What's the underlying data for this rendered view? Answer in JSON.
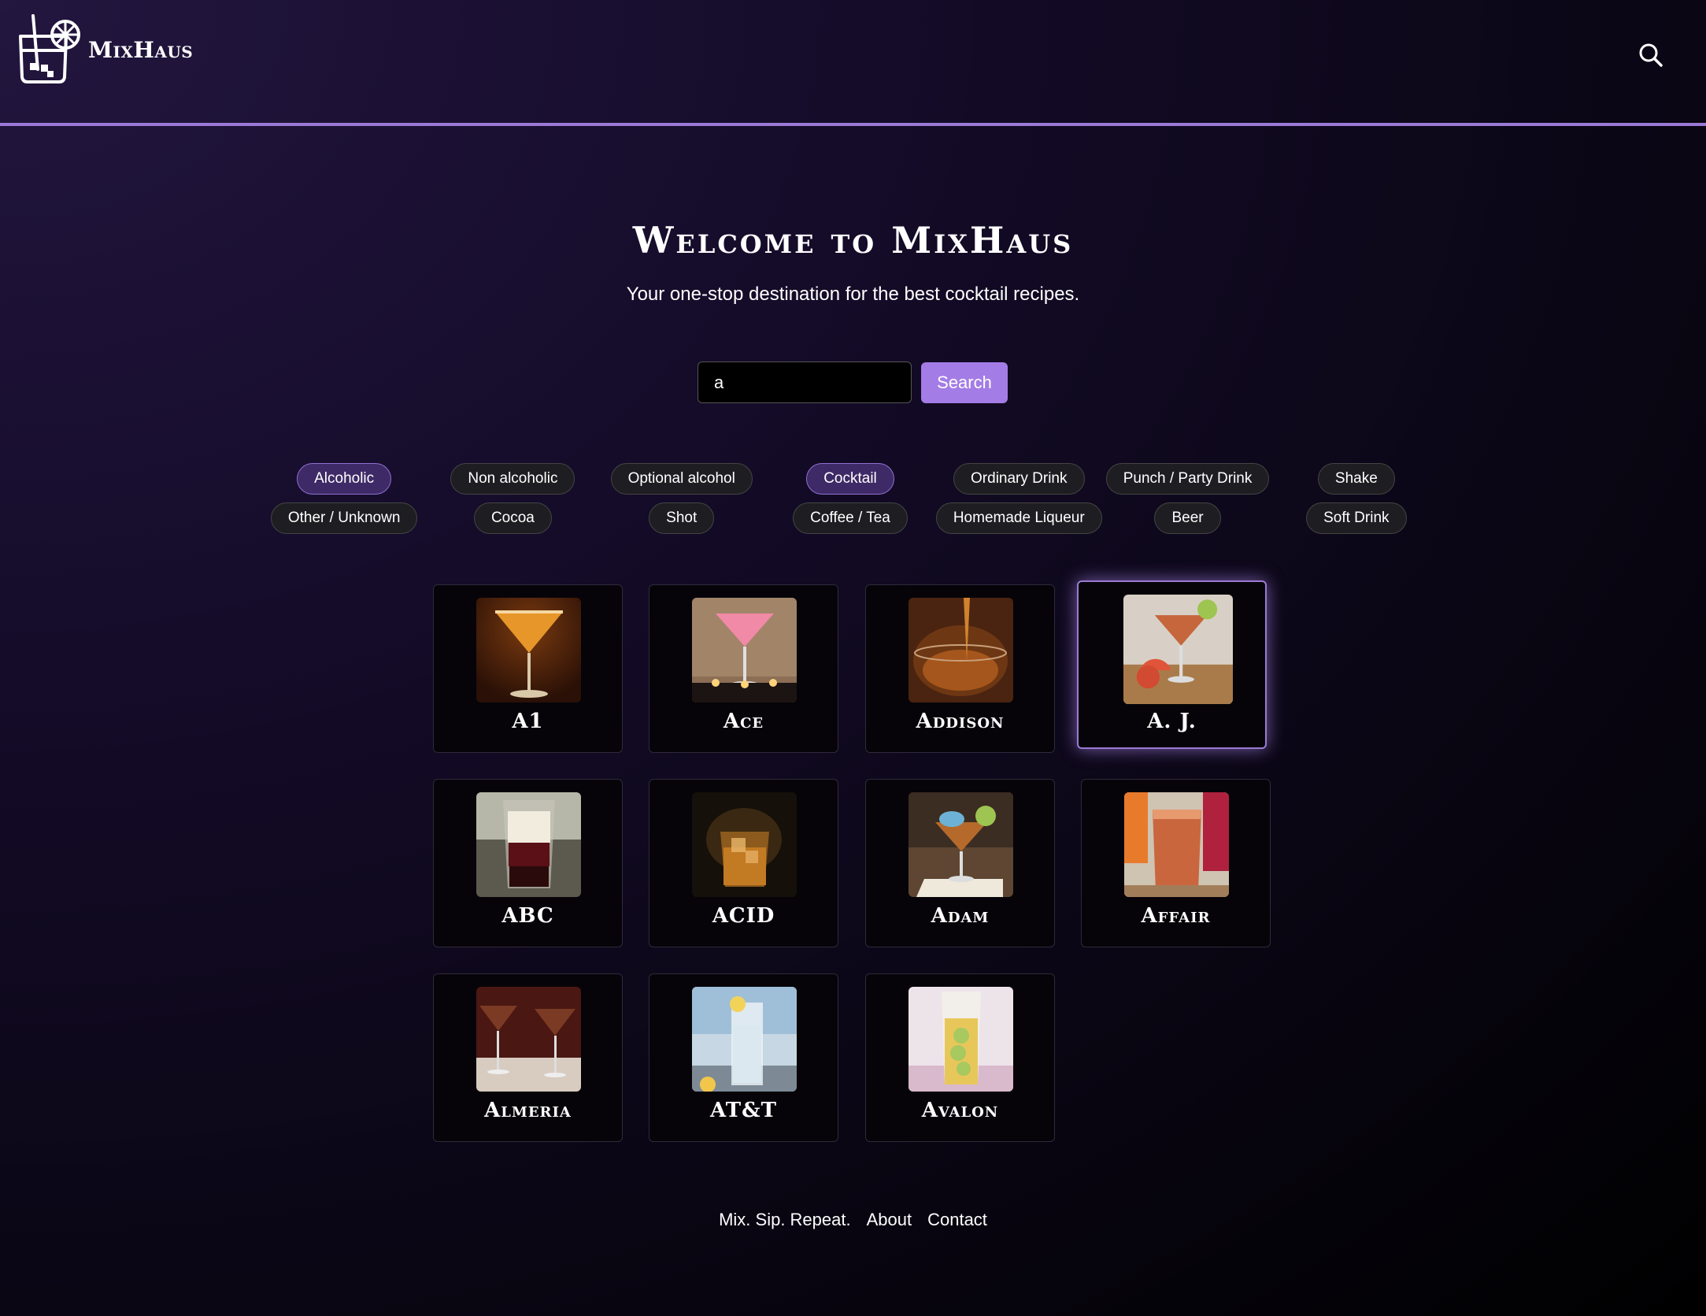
{
  "header": {
    "brand": "MixHaus",
    "search_icon": "search-icon",
    "logo_icon": "cocktail-glass-icon",
    "accent": "#9b7ad6"
  },
  "hero": {
    "title": "Welcome to MixHaus",
    "subtitle": "Your one-stop destination for the best cocktail recipes."
  },
  "search": {
    "value": "a",
    "button_label": "Search"
  },
  "filters": {
    "row1": [
      {
        "label": "Alcoholic",
        "active": true
      },
      {
        "label": "Non alcoholic",
        "active": false
      },
      {
        "label": "Optional alcohol",
        "active": false
      },
      {
        "label": "Cocktail",
        "active": true
      },
      {
        "label": "Ordinary Drink",
        "active": false
      },
      {
        "label": "Punch / Party Drink",
        "active": false
      },
      {
        "label": "Shake",
        "active": false
      }
    ],
    "row2": [
      {
        "label": "Other / Unknown",
        "active": false
      },
      {
        "label": "Cocoa",
        "active": false
      },
      {
        "label": "Shot",
        "active": false
      },
      {
        "label": "Coffee / Tea",
        "active": false
      },
      {
        "label": "Homemade Liqueur",
        "active": false
      },
      {
        "label": "Beer",
        "active": false
      },
      {
        "label": "Soft Drink",
        "active": false
      }
    ]
  },
  "drinks": [
    {
      "name": "A1"
    },
    {
      "name": "Ace"
    },
    {
      "name": "Addison"
    },
    {
      "name": "A. J."
    },
    {
      "name": "ABC"
    },
    {
      "name": "ACID"
    },
    {
      "name": "Adam"
    },
    {
      "name": "Affair"
    },
    {
      "name": "Almeria"
    },
    {
      "name": "AT&T"
    },
    {
      "name": "Avalon"
    }
  ],
  "footer": {
    "tagline": "Mix. Sip. Repeat.",
    "about": "About",
    "contact": "Contact"
  }
}
